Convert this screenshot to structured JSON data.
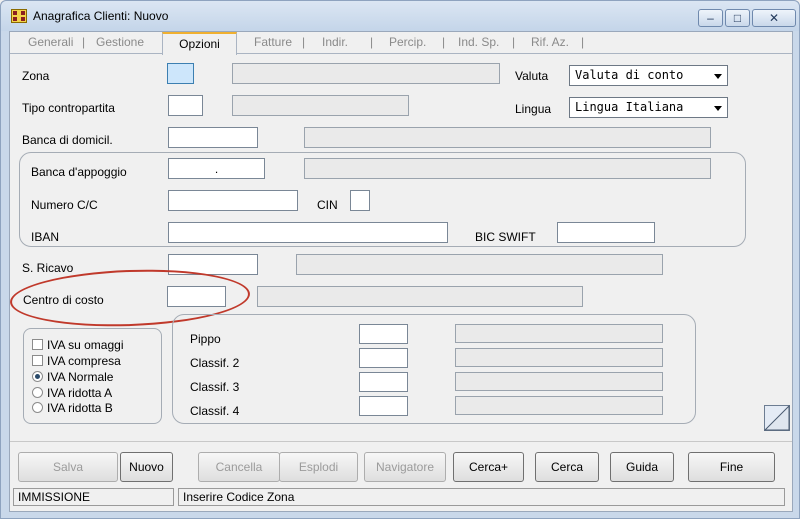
{
  "window": {
    "title": "Anagrafica Clienti: Nuovo"
  },
  "tabs": [
    "Generali",
    "Gestione",
    "Opzioni",
    "Fatture",
    "Indir.",
    "Percip.",
    "Ind. Sp.",
    "Rif. Az."
  ],
  "active_tab": "Opzioni",
  "form": {
    "zona_label": "Zona",
    "tipo_contropartita_label": "Tipo contropartita",
    "banca_domicil_label": "Banca di domicil.",
    "banca_appoggio_label": "Banca d'appoggio",
    "banca_appoggio_value": ".",
    "numero_cc_label": "Numero C/C",
    "cin_label": "CIN",
    "iban_label": "IBAN",
    "bic_swift_label": "BIC SWIFT",
    "s_ricavo_label": "S. Ricavo",
    "centro_costo_label": "Centro di costo",
    "valuta_label": "Valuta",
    "valuta_value": "Valuta di conto",
    "lingua_label": "Lingua",
    "lingua_value": "Lingua Italiana"
  },
  "iva_options": {
    "checkboxes": [
      {
        "label": "IVA su omaggi",
        "checked": false
      },
      {
        "label": "IVA compresa",
        "checked": false
      }
    ],
    "radios": [
      {
        "label": "IVA Normale",
        "selected": true
      },
      {
        "label": "IVA ridotta A",
        "selected": false
      },
      {
        "label": "IVA ridotta B",
        "selected": false
      }
    ]
  },
  "classif": {
    "pippo_label": "Pippo",
    "classif2_label": "Classif. 2",
    "classif3_label": "Classif. 3",
    "classif4_label": "Classif. 4"
  },
  "buttons": {
    "salva": "Salva",
    "nuovo": "Nuovo",
    "cancella": "Cancella",
    "esplodi": "Esplodi",
    "navigatore": "Navigatore",
    "cerca_plus": "Cerca+",
    "cerca": "Cerca",
    "guida": "Guida",
    "fine": "Fine"
  },
  "status": {
    "mode": "IMMISSIONE",
    "message": "Inserire Codice Zona"
  },
  "colors": {
    "annotation": "#c0392b",
    "focus_field": "#cde6fb",
    "active_tab_accent": "#f0b030"
  }
}
